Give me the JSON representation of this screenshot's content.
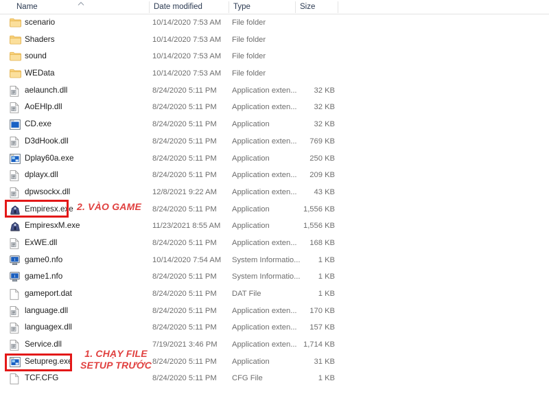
{
  "window": {
    "app": "windows-file-explorer"
  },
  "columns": {
    "name": "Name",
    "date_modified": "Date modified",
    "type": "Type",
    "size": "Size",
    "sort_indicator": "⌃"
  },
  "files": [
    {
      "name": "scenario",
      "date": "10/14/2020 7:53 AM",
      "type": "File folder",
      "size": "",
      "icon": "folder-icon"
    },
    {
      "name": "Shaders",
      "date": "10/14/2020 7:53 AM",
      "type": "File folder",
      "size": "",
      "icon": "folder-icon"
    },
    {
      "name": "sound",
      "date": "10/14/2020 7:53 AM",
      "type": "File folder",
      "size": "",
      "icon": "folder-icon"
    },
    {
      "name": "WEData",
      "date": "10/14/2020 7:53 AM",
      "type": "File folder",
      "size": "",
      "icon": "folder-icon"
    },
    {
      "name": "aelaunch.dll",
      "date": "8/24/2020 5:11 PM",
      "type": "Application exten...",
      "size": "32 KB",
      "icon": "dll-file-icon"
    },
    {
      "name": "AoEHlp.dll",
      "date": "8/24/2020 5:11 PM",
      "type": "Application exten...",
      "size": "32 KB",
      "icon": "dll-file-icon"
    },
    {
      "name": "CD.exe",
      "date": "8/24/2020 5:11 PM",
      "type": "Application",
      "size": "32 KB",
      "icon": "application-blue-icon"
    },
    {
      "name": "D3dHook.dll",
      "date": "8/24/2020 5:11 PM",
      "type": "Application exten...",
      "size": "769 KB",
      "icon": "dll-file-icon"
    },
    {
      "name": "Dplay60a.exe",
      "date": "8/24/2020 5:11 PM",
      "type": "Application",
      "size": "250 KB",
      "icon": "application-setup-icon"
    },
    {
      "name": "dplayx.dll",
      "date": "8/24/2020 5:11 PM",
      "type": "Application exten...",
      "size": "209 KB",
      "icon": "dll-file-icon"
    },
    {
      "name": "dpwsockx.dll",
      "date": "12/8/2021 9:22 AM",
      "type": "Application exten...",
      "size": "43 KB",
      "icon": "dll-file-icon"
    },
    {
      "name": "Empiresx.exe",
      "date": "8/24/2020 5:11 PM",
      "type": "Application",
      "size": "1,556 KB",
      "icon": "game-castle-icon"
    },
    {
      "name": "EmpiresxM.exe",
      "date": "11/23/2021 8:55 AM",
      "type": "Application",
      "size": "1,556 KB",
      "icon": "game-castle-icon"
    },
    {
      "name": "ExWE.dll",
      "date": "8/24/2020 5:11 PM",
      "type": "Application exten...",
      "size": "168 KB",
      "icon": "dll-file-icon"
    },
    {
      "name": "game0.nfo",
      "date": "10/14/2020 7:54 AM",
      "type": "System Informatio...",
      "size": "1 KB",
      "icon": "system-info-icon"
    },
    {
      "name": "game1.nfo",
      "date": "8/24/2020 5:11 PM",
      "type": "System Informatio...",
      "size": "1 KB",
      "icon": "system-info-icon"
    },
    {
      "name": "gameport.dat",
      "date": "8/24/2020 5:11 PM",
      "type": "DAT File",
      "size": "1 KB",
      "icon": "blank-file-icon"
    },
    {
      "name": "language.dll",
      "date": "8/24/2020 5:11 PM",
      "type": "Application exten...",
      "size": "170 KB",
      "icon": "dll-file-icon"
    },
    {
      "name": "languagex.dll",
      "date": "8/24/2020 5:11 PM",
      "type": "Application exten...",
      "size": "157 KB",
      "icon": "dll-file-icon"
    },
    {
      "name": "Service.dll",
      "date": "7/19/2021 3:46 PM",
      "type": "Application exten...",
      "size": "1,714 KB",
      "icon": "dll-file-icon"
    },
    {
      "name": "Setupreg.exe",
      "date": "8/24/2020 5:11 PM",
      "type": "Application",
      "size": "31 KB",
      "icon": "application-setup-icon"
    },
    {
      "name": "TCF.CFG",
      "date": "8/24/2020 5:11 PM",
      "type": "CFG File",
      "size": "1 KB",
      "icon": "blank-file-icon"
    }
  ],
  "annotations": {
    "step2": {
      "text": "2. VÀO GAME",
      "target": "Empiresx.exe"
    },
    "step1": {
      "line1": "1. CHẠY FILE",
      "line2": "SETUP TRƯỚC",
      "target": "Setupreg.exe"
    }
  },
  "colors": {
    "annotation_red": "#e0403f",
    "highlight_box_red": "#e31818",
    "folder_yellow": "#f7cf71",
    "header_text": "#2b3a52"
  }
}
